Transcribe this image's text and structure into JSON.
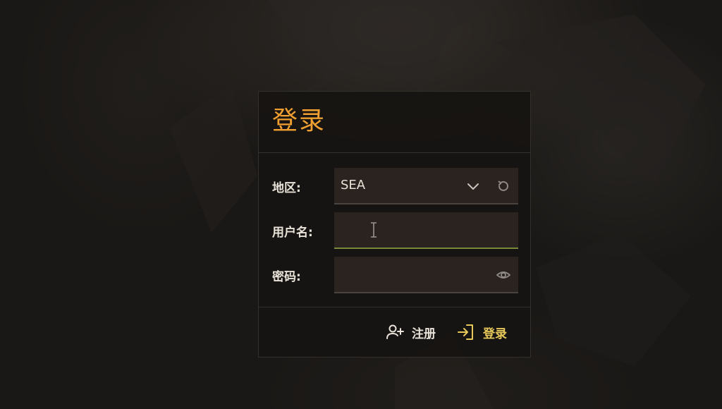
{
  "dialog": {
    "title": "登录"
  },
  "form": {
    "region": {
      "label": "地区:",
      "value": "SEA"
    },
    "username": {
      "label": "用户名:",
      "value": "",
      "placeholder": ""
    },
    "password": {
      "label": "密码:",
      "value": "",
      "placeholder": ""
    }
  },
  "footer": {
    "register_label": "注册",
    "login_label": "登录"
  },
  "colors": {
    "accent_title": "#f0a030",
    "login_accent": "#e7c95a",
    "focus_underline": "#7a8a3a"
  },
  "icons": {
    "region_dropdown": "chevron-down-icon",
    "region_reset": "refresh-icon",
    "password_toggle": "eye-icon",
    "register": "add-user-icon",
    "login": "login-arrow-icon"
  }
}
